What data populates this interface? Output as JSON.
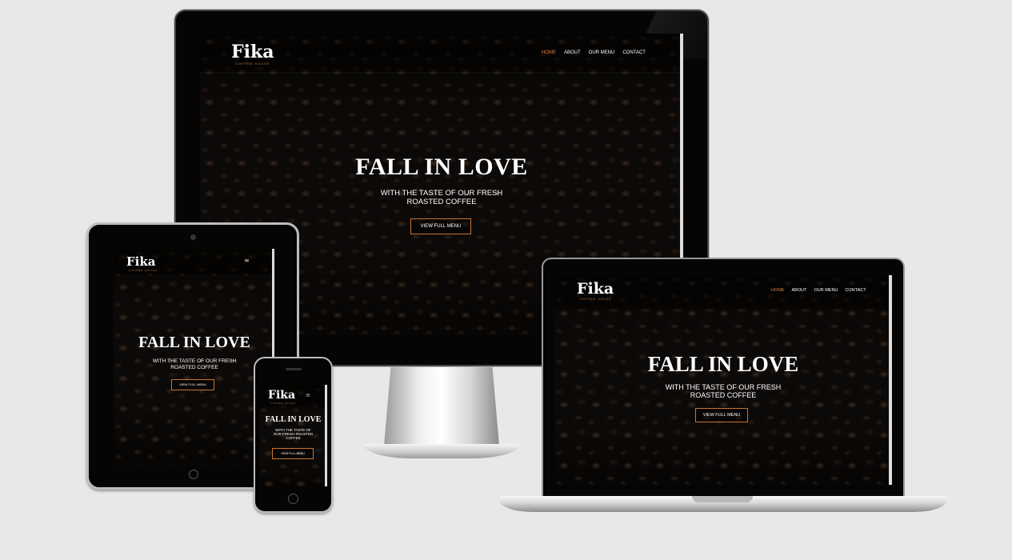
{
  "site": {
    "logo": "Fika",
    "logo_sub": "COFFEE HOUSE",
    "nav": [
      "HOME",
      "ABOUT",
      "OUR MENU",
      "CONTACT"
    ],
    "hero_title": "FALL IN LOVE",
    "hero_sub_line1": "WITH THE TASTE OF OUR FRESH",
    "hero_sub_line2": "ROASTED COFFEE",
    "phone_sub_line1": "WITH THE TASTE OF",
    "phone_sub_line2": "OUR FRESH ROASTED",
    "phone_sub_line3": "COFFEE",
    "cta": "VIEW FULL MENU",
    "hamburger": "≡"
  },
  "colors": {
    "accent": "#e07f3b",
    "button_border": "#c9742f",
    "backdrop": "#e8e8e8"
  }
}
